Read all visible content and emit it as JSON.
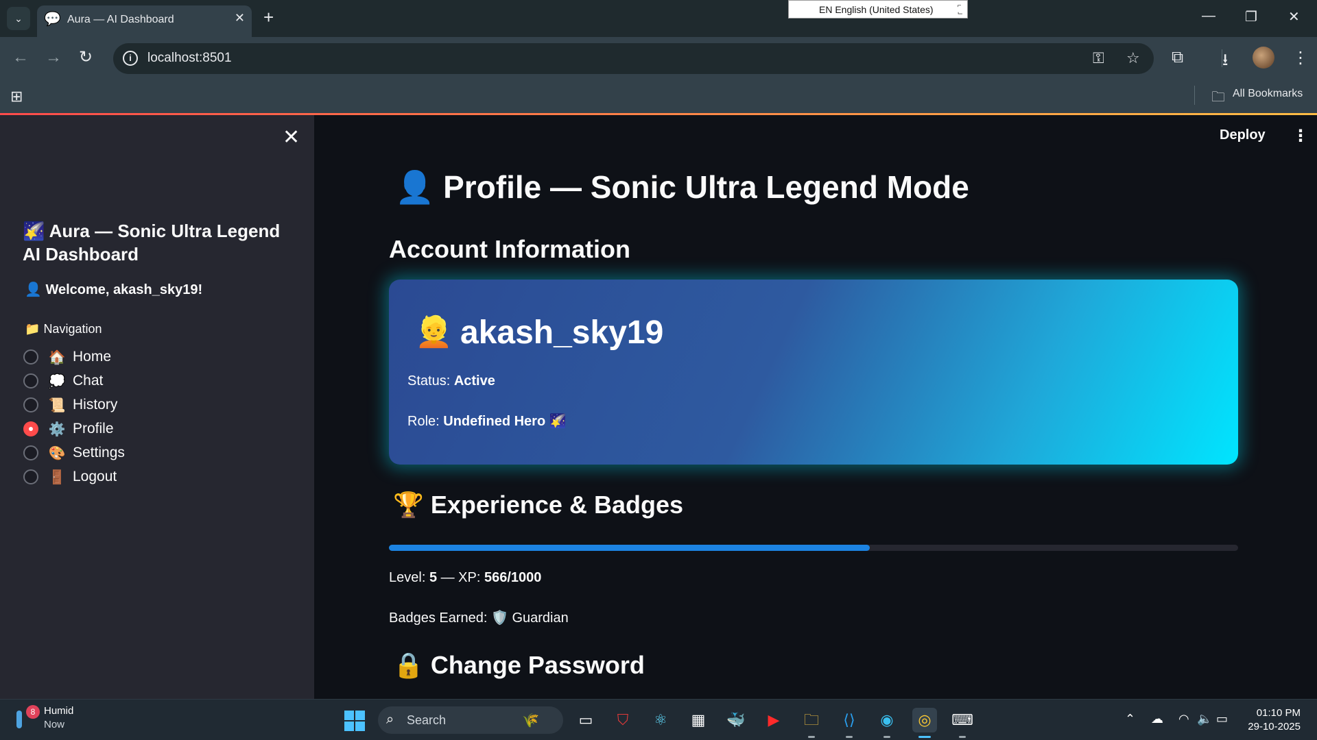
{
  "browser": {
    "tab_title": "Aura — AI Dashboard",
    "tab_favicon": "💬",
    "url": "localhost:8501",
    "ime_indicator": "EN English (United States)",
    "bookmarks_label": "All Bookmarks"
  },
  "app": {
    "deploy_label": "Deploy"
  },
  "sidebar": {
    "title_icon": "🌠",
    "title": "Aura — Sonic Ultra Legend AI Dashboard",
    "welcome_icon": "👤",
    "welcome": "Welcome, akash_sky19!",
    "nav_icon": "📁",
    "nav_label": "Navigation",
    "items": [
      {
        "icon": "🏠",
        "label": "Home",
        "selected": false
      },
      {
        "icon": "💭",
        "label": "Chat",
        "selected": false
      },
      {
        "icon": "📜",
        "label": "History",
        "selected": false
      },
      {
        "icon": "⚙️",
        "label": "Profile",
        "selected": true
      },
      {
        "icon": "🎨",
        "label": "Settings",
        "selected": false
      },
      {
        "icon": "🚪",
        "label": "Logout",
        "selected": false
      }
    ]
  },
  "main": {
    "title_icon": "👤",
    "title": "Profile — Sonic Ultra Legend Mode",
    "account_header": "Account Information",
    "card": {
      "user_icon": "👱",
      "username": "akash_sky19",
      "status_label": "Status:",
      "status_value": "Active",
      "role_label": "Role:",
      "role_value": "Undefined Hero",
      "role_icon": "🌠"
    },
    "xp_header_icon": "🏆",
    "xp_header": "Experience & Badges",
    "xp_progress": 0.566,
    "level_label": "Level:",
    "level_value": "5",
    "xp_label": "— XP:",
    "xp_value": "566/1000",
    "badges_label": "Badges Earned:",
    "badge_icon": "🛡️",
    "badge_name": "Guardian",
    "password_header_icon": "🔒",
    "password_header": "Change Password"
  },
  "taskbar": {
    "weather_badge": "8",
    "weather_title": "Humid",
    "weather_sub": "Now",
    "search_placeholder": "Search",
    "time": "01:10 PM",
    "date": "29-10-2025"
  }
}
